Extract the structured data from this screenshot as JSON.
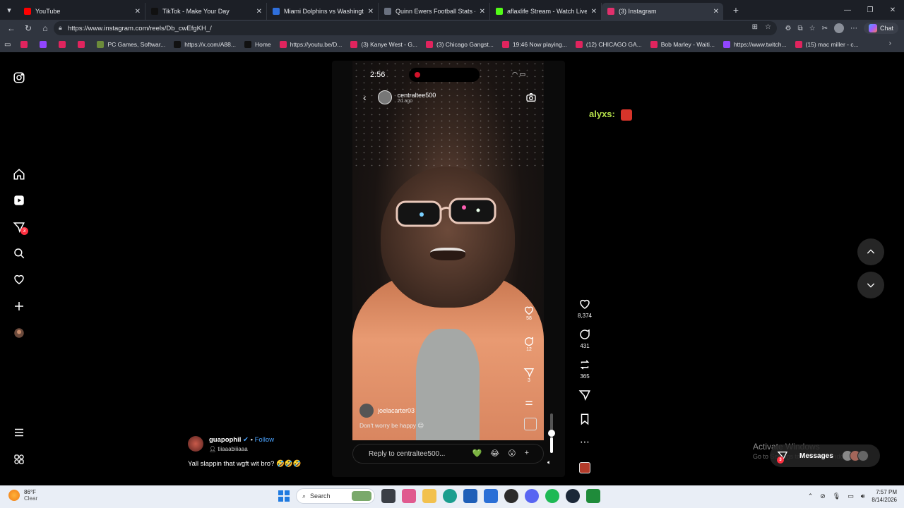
{
  "browser": {
    "tabs": [
      {
        "label": "YouTube",
        "color": "#ff0000",
        "active": false
      },
      {
        "label": "TikTok - Make Your Day",
        "color": "#111111",
        "active": false
      },
      {
        "label": "Miami Dolphins vs Washington Co",
        "color": "#2f6fdc",
        "active": false
      },
      {
        "label": "Quinn Ewers Football Stats - Sear",
        "color": "#6a7180",
        "active": false
      },
      {
        "label": "aflaxlife Stream - Watch Live on Ki",
        "color": "#53fc18",
        "active": false
      },
      {
        "label": "(3) Instagram",
        "color": "#e1306c",
        "active": true
      }
    ],
    "url": "https://www.instagram.com/reels/Db_cwEfgKH_/",
    "chat_label": "Chat",
    "bookmarks": [
      {
        "label": "",
        "color": "#e0245e"
      },
      {
        "label": "",
        "color": "#9146ff"
      },
      {
        "label": "",
        "color": "#e0245e"
      },
      {
        "label": "",
        "color": "#e0245e"
      },
      {
        "label": "PC Games, Softwar...",
        "color": "#6c8b3a"
      },
      {
        "label": "https://x.com/A88...",
        "color": "#111111"
      },
      {
        "label": "Home",
        "color": "#111111"
      },
      {
        "label": "https://youtu.be/D...",
        "color": "#e0245e"
      },
      {
        "label": "(3) Kanye West - G...",
        "color": "#e0245e"
      },
      {
        "label": "(3) Chicago Gangst...",
        "color": "#e0245e"
      },
      {
        "label": "19:46 Now playing...",
        "color": "#e0245e"
      },
      {
        "label": "(12) CHICAGO GA...",
        "color": "#e0245e"
      },
      {
        "label": "Bob Marley - Waiti...",
        "color": "#e0245e"
      },
      {
        "label": "https://www.twitch...",
        "color": "#9146ff"
      },
      {
        "label": "(15) mac miller - c...",
        "color": "#e0245e"
      }
    ]
  },
  "sidebar": {
    "messages_badge": "3"
  },
  "story": {
    "time": "2:56",
    "username": "centraltee500",
    "posted": "2d ago",
    "like_count": "58",
    "comment_count": "12",
    "share_count": "3",
    "reply_user": "joelacarter03",
    "reply_message": "Don't worry be happy 😊",
    "reply_placeholder": "Reply to centraltee500...",
    "reply_emojis": [
      "💚",
      "😂",
      "😮",
      "+"
    ]
  },
  "reel": {
    "likes": "8,374",
    "comments": "431",
    "reposts": "365",
    "volume_level": 0.45
  },
  "caption": {
    "username": "guapophil",
    "follow": "Follow",
    "audio": "tiiaaabiiiaaa",
    "text": "Yall slappin that wgft wit bro? 🤣🤣🤣"
  },
  "overlay": {
    "chat_text": "alyxs:"
  },
  "windows": {
    "activate_title": "Activate Windows",
    "activate_sub": "Go to Settings to activate Windows.",
    "messages_label": "Messages",
    "messages_badge": "3"
  },
  "taskbar": {
    "temperature": "86°F",
    "condition": "Clear",
    "search": "Search",
    "time": "7:57 PM",
    "date": "8/14/2026"
  }
}
